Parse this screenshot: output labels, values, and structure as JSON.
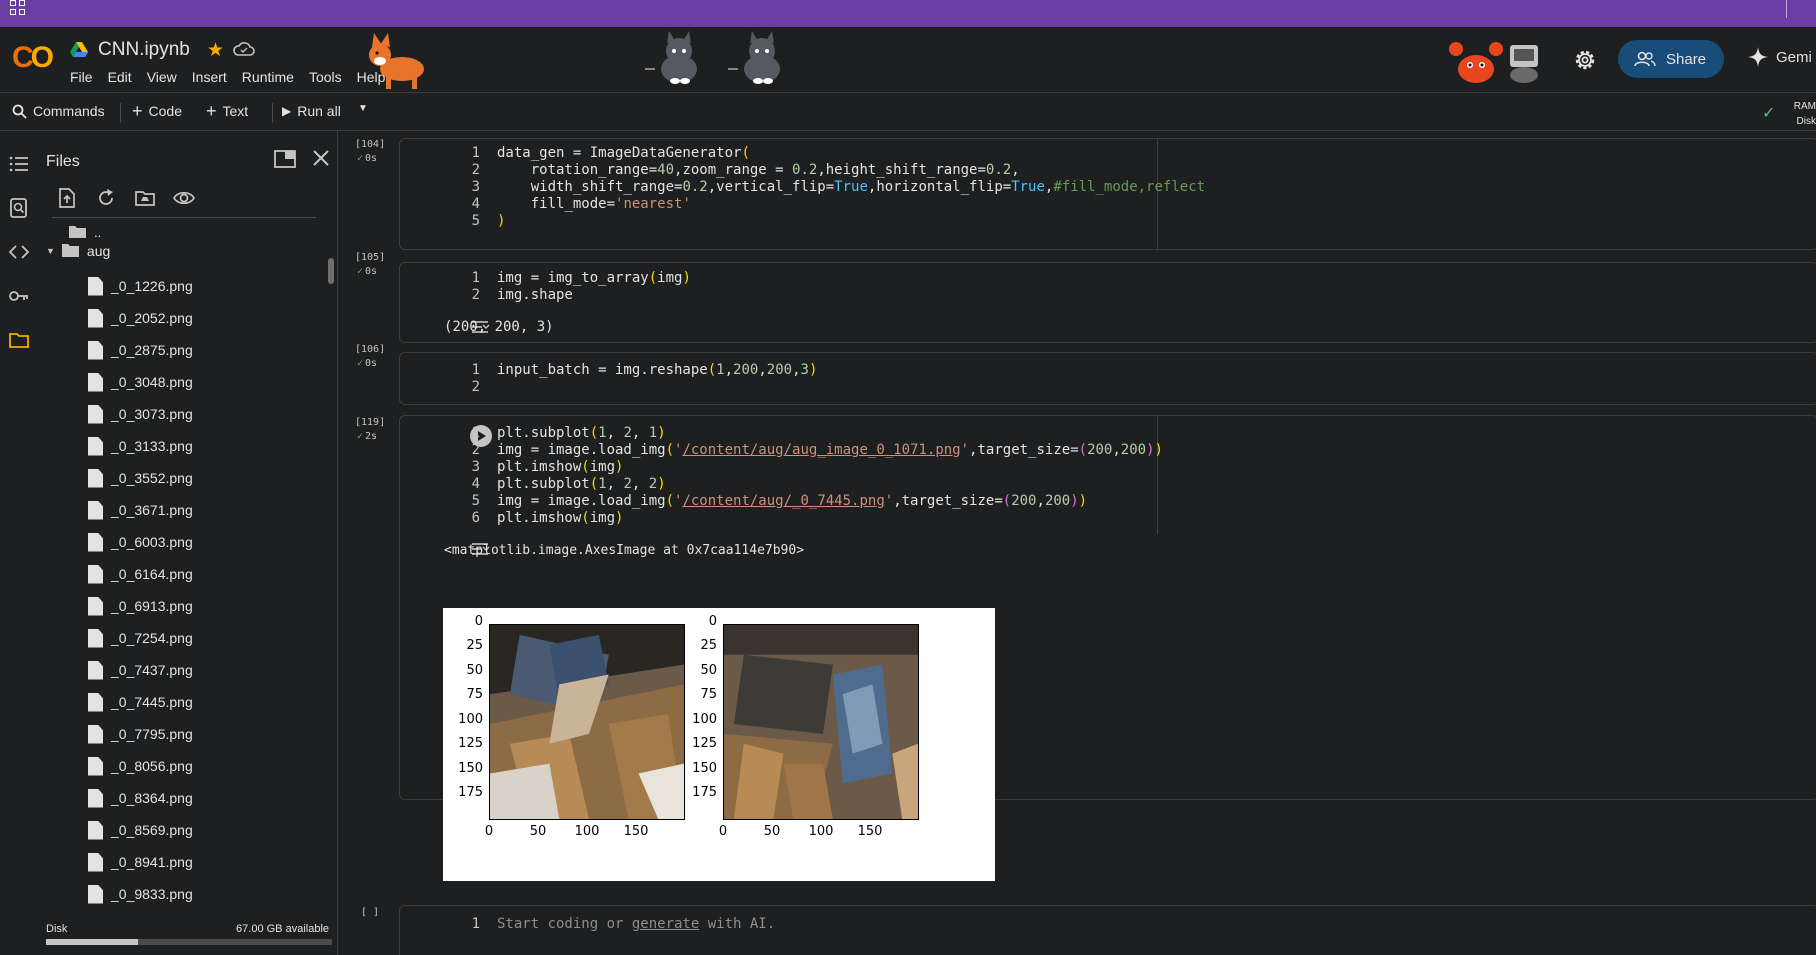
{
  "app": {
    "notebook_title": "CNN.ipynb",
    "menu": [
      "File",
      "Edit",
      "View",
      "Insert",
      "Runtime",
      "Tools",
      "Help"
    ],
    "share_label": "Share",
    "gemini_label": "Gemi",
    "ram_label": "RAM",
    "disk_label_short": "Disk"
  },
  "toolbar": {
    "commands": "Commands",
    "code": "Code",
    "text": "Text",
    "run_all": "Run all"
  },
  "files": {
    "title": "Files",
    "parent": "..",
    "folder": "aug",
    "items": [
      "_0_1226.png",
      "_0_2052.png",
      "_0_2875.png",
      "_0_3048.png",
      "_0_3073.png",
      "_0_3133.png",
      "_0_3552.png",
      "_0_3671.png",
      "_0_6003.png",
      "_0_6164.png",
      "_0_6913.png",
      "_0_7254.png",
      "_0_7437.png",
      "_0_7445.png",
      "_0_7795.png",
      "_0_8056.png",
      "_0_8364.png",
      "_0_8569.png",
      "_0_8941.png",
      "_0_9833.png"
    ],
    "disk_label": "Disk",
    "disk_available": "67.00 GB available",
    "disk_used_fraction": 0.32
  },
  "cells": {
    "c104": {
      "exec": "[104]",
      "time": "0s",
      "lines": [
        "1",
        "2",
        "3",
        "4",
        "5"
      ]
    },
    "c105": {
      "exec": "[105]",
      "time": "0s",
      "lines": [
        "1",
        "2"
      ],
      "code": [
        "img = img_to_array(img)",
        "img.shape"
      ],
      "output": "(200, 200, 3)"
    },
    "c106": {
      "exec": "[106]",
      "time": "0s",
      "lines": [
        "1",
        "2"
      ]
    },
    "c119": {
      "exec": "[119]",
      "time": "2s",
      "lines": [
        "1",
        "2",
        "3",
        "4",
        "5",
        "6"
      ],
      "output": "<matplotlib.image.AxesImage at 0x7caa114e7b90>"
    },
    "empty": {
      "exec": "[ ]",
      "line": "1",
      "placeholder_pre": "Start coding or ",
      "placeholder_link": "generate",
      "placeholder_post": " with AI."
    }
  },
  "plot": {
    "y_ticks": [
      "0",
      "25",
      "50",
      "75",
      "100",
      "125",
      "150",
      "175"
    ],
    "x_ticks": [
      "0",
      "50",
      "100",
      "150"
    ]
  }
}
